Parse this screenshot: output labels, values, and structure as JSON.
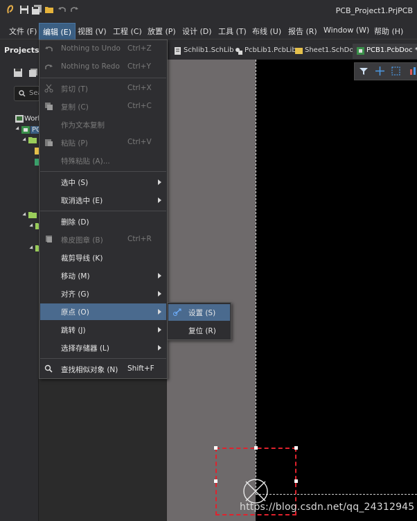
{
  "title_bar": {
    "title": "PCB_Project1.PrjPCB"
  },
  "menu_bar": {
    "items": [
      "文件 (F)",
      "编辑 (E)",
      "视图 (V)",
      "工程 (C)",
      "放置 (P)",
      "设计 (D)",
      "工具 (T)",
      "布线 (U)",
      "报告 (R)",
      "Window (W)",
      "帮助 (H)"
    ]
  },
  "projects_panel": {
    "title": "Projects",
    "search_placeholder": "Sea",
    "tree": [
      "Work",
      "PCB"
    ]
  },
  "tabs": [
    "Schlib1.SchLib",
    "PcbLib1.PcbLib",
    "Sheet1.SchDoc",
    "PCB1.PcbDoc *"
  ],
  "edit_menu": {
    "items": [
      {
        "label": "Nothing to Undo",
        "shortcut": "Ctrl+Z",
        "disabled": true
      },
      {
        "label": "Nothing to Redo",
        "shortcut": "Ctrl+Y",
        "disabled": true
      },
      {
        "label": "剪切 (T)",
        "shortcut": "Ctrl+X",
        "disabled": true
      },
      {
        "label": "复制 (C)",
        "shortcut": "Ctrl+C",
        "disabled": true
      },
      {
        "label": "作为文本复制",
        "shortcut": "",
        "disabled": true
      },
      {
        "label": "粘贴 (P)",
        "shortcut": "Ctrl+V",
        "disabled": true
      },
      {
        "label": "特殊粘贴 (A)...",
        "shortcut": "",
        "disabled": true
      },
      {
        "label": "选中 (S)",
        "shortcut": "",
        "disabled": false
      },
      {
        "label": "取消选中 (E)",
        "shortcut": "",
        "disabled": false
      },
      {
        "label": "删除 (D)",
        "shortcut": "",
        "disabled": false
      },
      {
        "label": "橡皮图章 (B)",
        "shortcut": "Ctrl+R",
        "disabled": true
      },
      {
        "label": "裁剪导线 (K)",
        "shortcut": "",
        "disabled": false
      },
      {
        "label": "移动 (M)",
        "shortcut": "",
        "disabled": false
      },
      {
        "label": "对齐 (G)",
        "shortcut": "",
        "disabled": false
      },
      {
        "label": "原点 (O)",
        "shortcut": "",
        "disabled": false
      },
      {
        "label": "跳转 (J)",
        "shortcut": "",
        "disabled": false
      },
      {
        "label": "选择存储器 (L)",
        "shortcut": "",
        "disabled": false
      },
      {
        "label": "查找相似对象 (N)",
        "shortcut": "Shift+F",
        "disabled": false
      }
    ]
  },
  "origin_submenu": {
    "items": [
      "设置 (S)",
      "复位 (R)"
    ]
  },
  "watermark": "https://blog.csdn.net/qq_24312945"
}
